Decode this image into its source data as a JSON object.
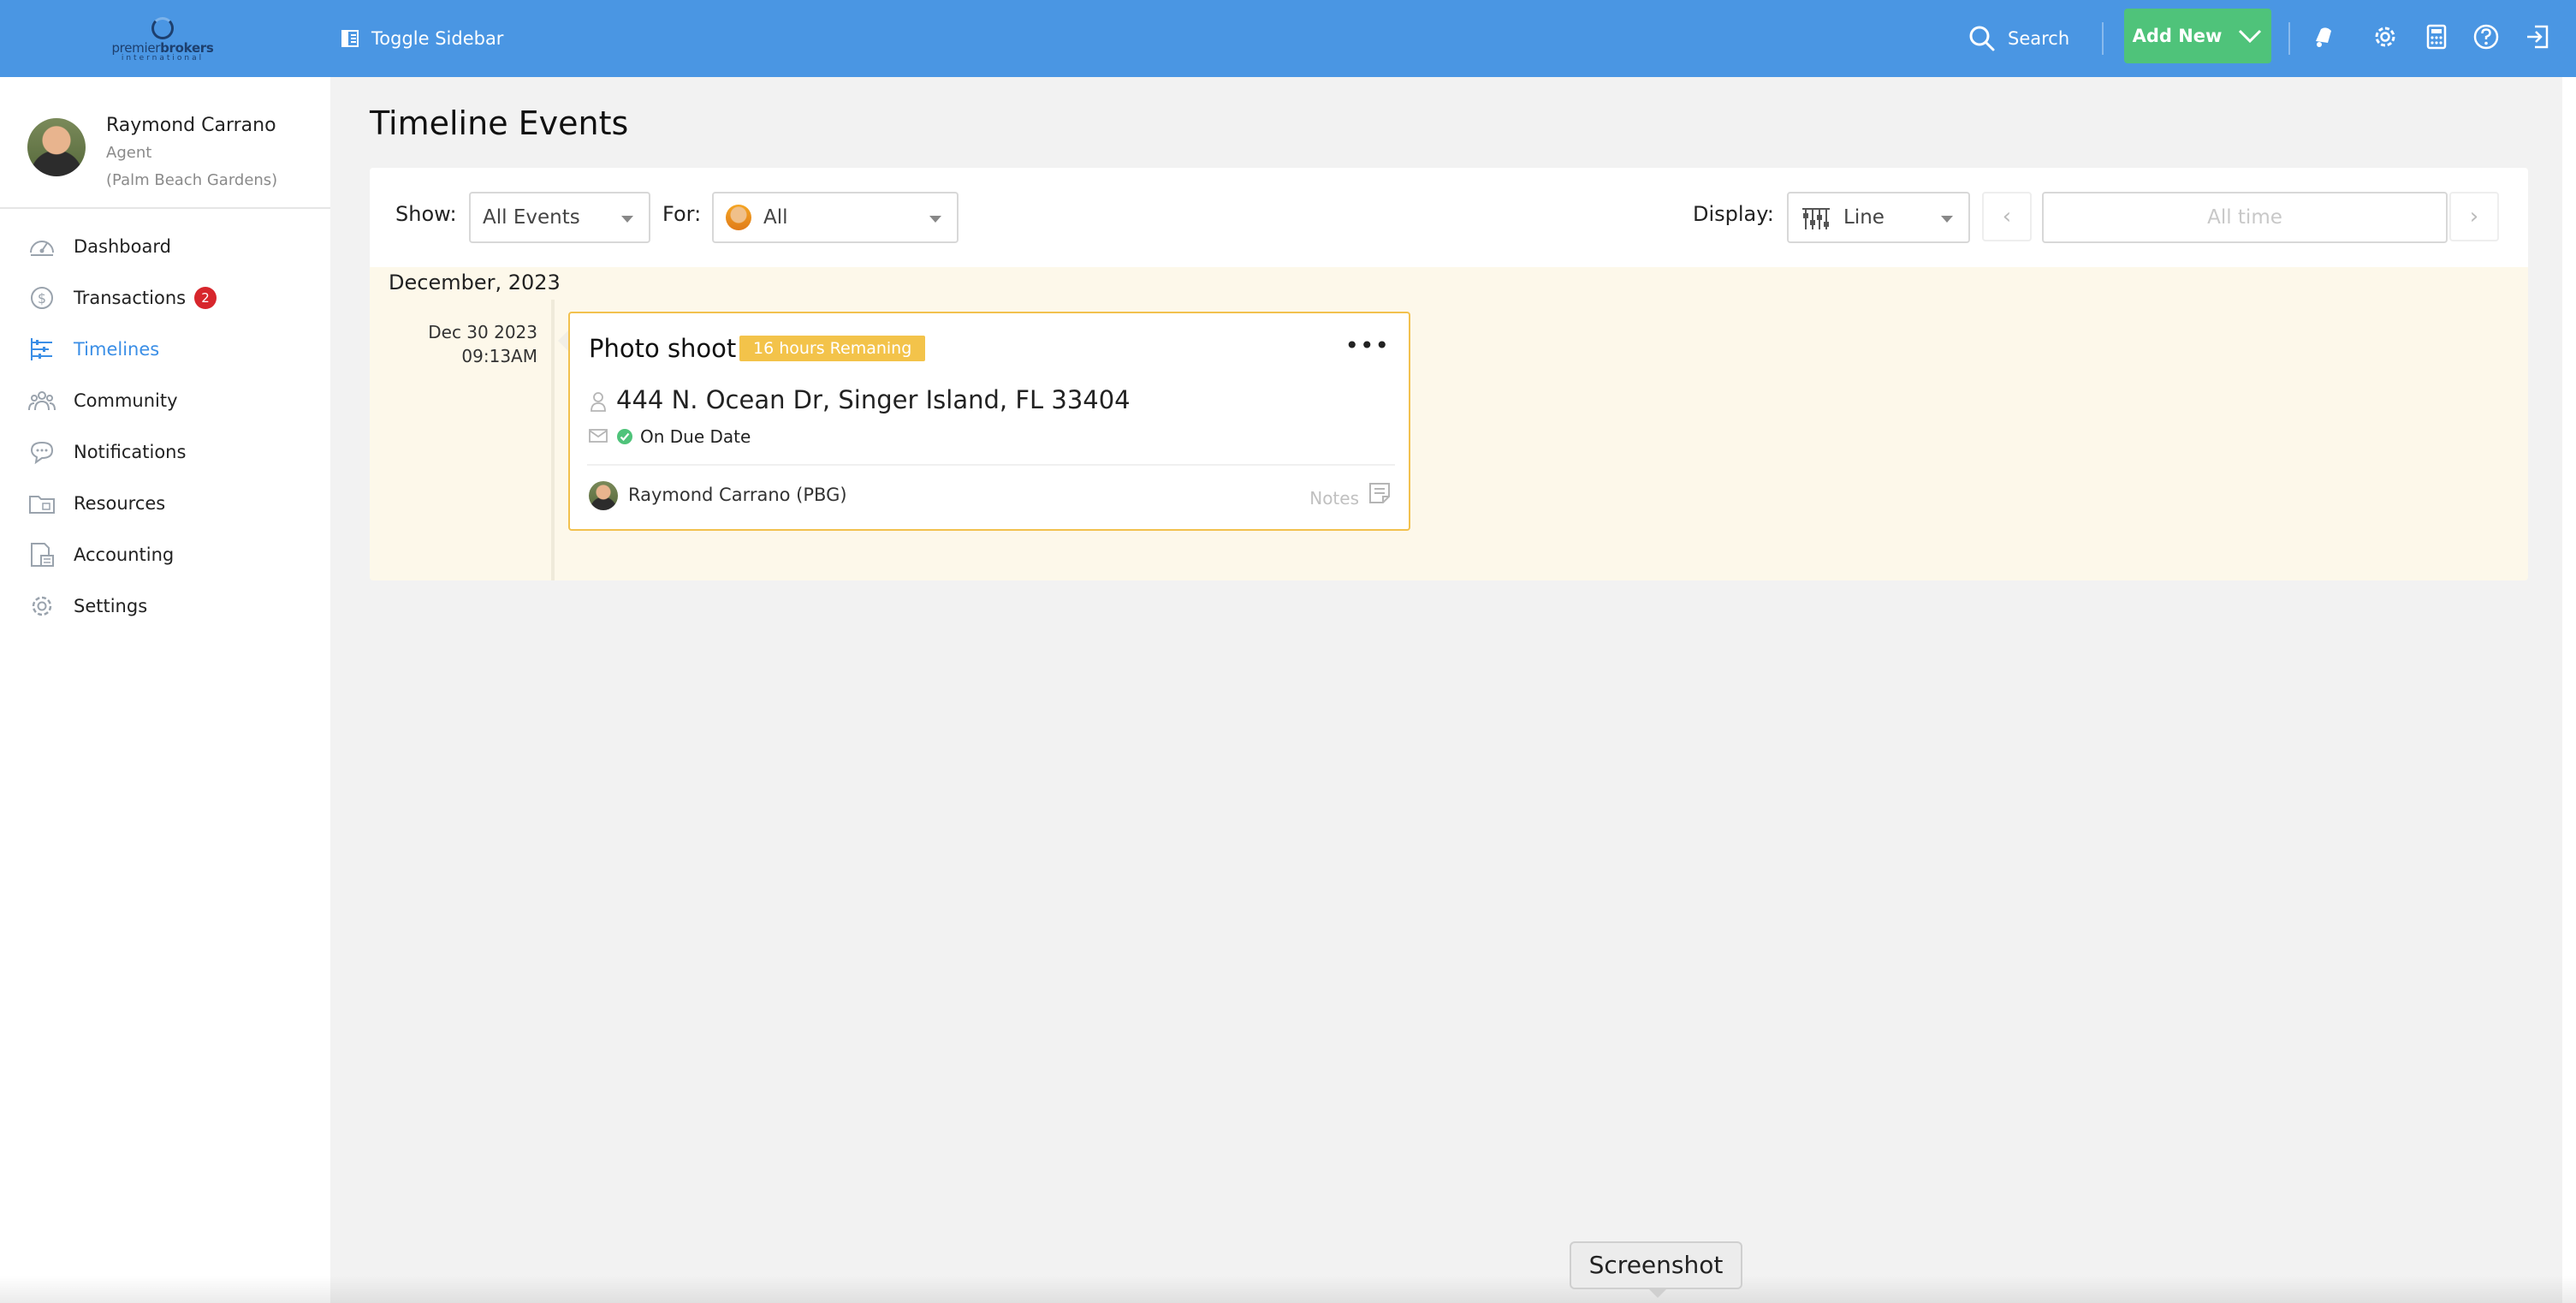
{
  "brand": {
    "logo_text_light": "premier",
    "logo_text_bold": "brokers",
    "logo_sub": "international"
  },
  "topbar": {
    "toggle_sidebar_label": "Toggle Sidebar",
    "search_label": "Search",
    "add_new_label": "Add New",
    "icons": [
      "bell-icon",
      "gear-icon",
      "calculator-icon",
      "help-icon",
      "logout-icon"
    ]
  },
  "profile": {
    "name": "Raymond Carrano",
    "role": "Agent",
    "office": "(Palm Beach Gardens)"
  },
  "sidebar": {
    "items": [
      {
        "label": "Dashboard",
        "icon": "dashboard-icon",
        "active": false
      },
      {
        "label": "Transactions",
        "icon": "dollar-icon",
        "active": false,
        "badge": "2"
      },
      {
        "label": "Timelines",
        "icon": "timeline-icon",
        "active": true
      },
      {
        "label": "Community",
        "icon": "community-icon",
        "active": false
      },
      {
        "label": "Notifications",
        "icon": "chat-icon",
        "active": false
      },
      {
        "label": "Resources",
        "icon": "folder-icon",
        "active": false
      },
      {
        "label": "Accounting",
        "icon": "accounting-icon",
        "active": false
      },
      {
        "label": "Settings",
        "icon": "gear-icon",
        "active": false
      }
    ]
  },
  "page": {
    "title": "Timeline Events"
  },
  "filters": {
    "show_label": "Show:",
    "show_value": "All Events",
    "for_label": "For:",
    "for_value": "All",
    "display_label": "Display:",
    "display_value": "Line",
    "date_range_placeholder": "All time"
  },
  "timeline": {
    "month": "December, 2023",
    "event": {
      "date": "Dec 30 2023",
      "time": "09:13AM",
      "title": "Photo shoot",
      "badge": "16 hours Remaning",
      "address": "444 N. Ocean Dr, Singer Island, FL 33404",
      "status": "On Due Date",
      "agent": "Raymond Carrano (PBG)",
      "notes_label": "Notes",
      "menu": "•••"
    }
  },
  "tooltip": {
    "text": "Screenshot"
  },
  "colors": {
    "topbar": "#4a96e3",
    "accent": "#3a8ee6",
    "add_new": "#4fc37a",
    "badge_warning": "#f3c34a",
    "badge_red": "#d7262c",
    "panel_bg": "#fdf8ea"
  }
}
